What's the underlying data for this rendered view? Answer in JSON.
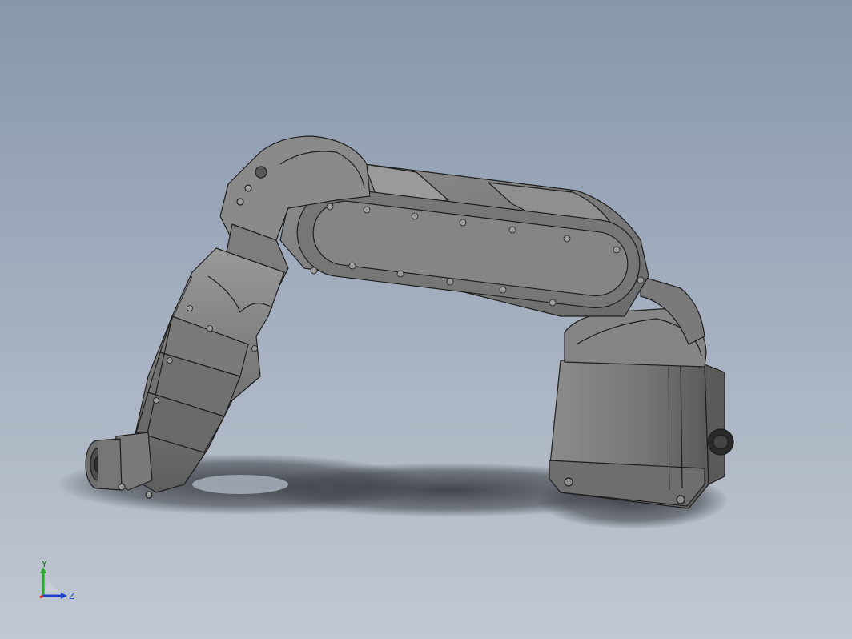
{
  "viewport": {
    "background_top": "#8797ac",
    "background_bottom": "#c2c8d2"
  },
  "model": {
    "body_color": "#7c7c7c",
    "edge_color": "#1e1e1e",
    "shadow_color": "#3a3d42"
  },
  "triad": {
    "x_axis_color": "#d42a2a",
    "y_axis_color": "#2aa82a",
    "z_axis_color": "#1e3fc8",
    "y_label": "Y",
    "z_label": "Z"
  }
}
